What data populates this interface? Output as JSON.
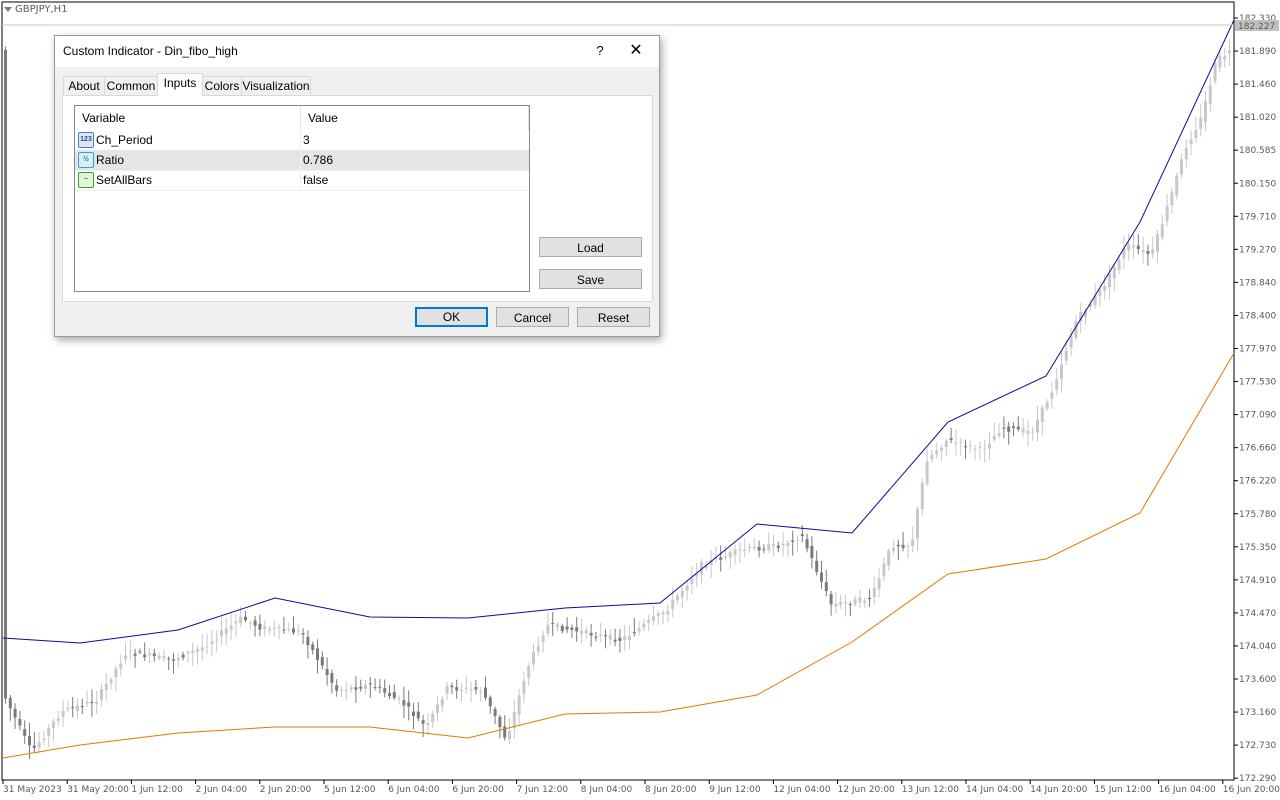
{
  "chart": {
    "symbol_label": "GBPJPY,H1",
    "current_price": "182.227",
    "y_ticks": [
      "182.330",
      "181.890",
      "181.460",
      "181.020",
      "180.585",
      "180.150",
      "179.710",
      "179.270",
      "178.840",
      "178.400",
      "177.970",
      "177.530",
      "177.090",
      "176.660",
      "176.220",
      "175.780",
      "175.350",
      "174.910",
      "174.470",
      "174.040",
      "173.600",
      "173.160",
      "172.730",
      "172.290"
    ],
    "x_ticks": [
      "31 May 2023",
      "31 May 20:00",
      "1 Jun 12:00",
      "2 Jun 04:00",
      "2 Jun 20:00",
      "5 Jun 12:00",
      "6 Jun 04:00",
      "6 Jun 20:00",
      "7 Jun 12:00",
      "8 Jun 04:00",
      "8 Jun 20:00",
      "9 Jun 12:00",
      "12 Jun 04:00",
      "12 Jun 20:00",
      "13 Jun 12:00",
      "14 Jun 04:00",
      "14 Jun 20:00",
      "15 Jun 12:00",
      "16 Jun 04:00",
      "16 Jun 20:00"
    ],
    "colors": {
      "upper_line": "#0a0aa0",
      "lower_line": "#e07b00",
      "bull_candle": "#c8c8c8",
      "bear_candle": "#7a7a7a"
    }
  },
  "dialog": {
    "title": "Custom Indicator - Din_fibo_high",
    "help_label": "?",
    "close_label": "✕",
    "tabs": [
      {
        "label": "About"
      },
      {
        "label": "Common"
      },
      {
        "label": "Inputs"
      },
      {
        "label": "Colors"
      },
      {
        "label": "Visualization"
      }
    ],
    "active_tab": "Inputs",
    "grid": {
      "header_variable": "Variable",
      "header_value": "Value",
      "rows": [
        {
          "icon": "123",
          "name": "Ch_Period",
          "value": "3"
        },
        {
          "icon": "½",
          "name": "Ratio",
          "value": "0.786"
        },
        {
          "icon": "~",
          "name": "SetAllBars",
          "value": "false"
        }
      ]
    },
    "buttons": {
      "load": "Load",
      "save": "Save",
      "ok": "OK",
      "cancel": "Cancel",
      "reset": "Reset"
    }
  }
}
